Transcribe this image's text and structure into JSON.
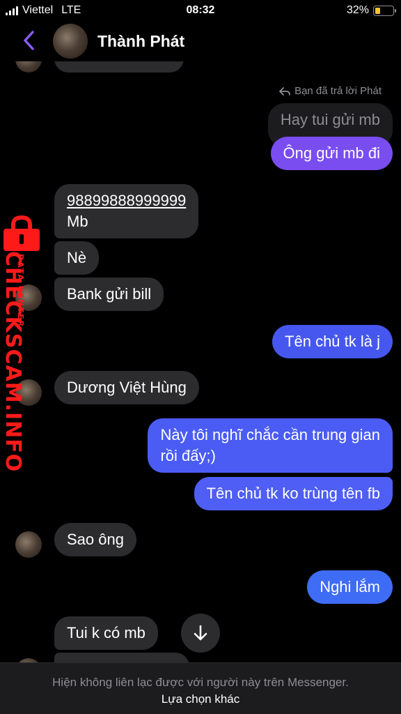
{
  "status_bar": {
    "carrier": "Viettel",
    "network": "LTE",
    "time": "08:32",
    "battery": "32%",
    "battery_level": 0.32,
    "battery_color": "#f4c430"
  },
  "header": {
    "contact_name": "Thành Phát",
    "back_icon": "chevron-left-icon",
    "accent": "#8b5cf6"
  },
  "reply_note": "Bạn đã trả lời Phát",
  "messages": {
    "quoted": "Hay tui gửi mb",
    "m1": "Ông gửi mb đi",
    "m2_line1": "98899888999999",
    "m2_line2": "Mb",
    "m3": "Nè",
    "m4": "Bank gửi bill",
    "m5": "Tên chủ tk là j",
    "m6": "Dương Việt Hùng",
    "m7_line1": "Này tôi nghĩ chắc cần trung gian",
    "m7_line2": "rồi đấy;)",
    "m8": "Tên chủ tk ko trùng tên fb",
    "m9": "Sao ông",
    "m10": "Nghi lắm",
    "m11": "Tui k có mb"
  },
  "watermark": {
    "main": "CHECKSCAM.INFO",
    "sub": "DATA CENTER"
  },
  "footer": {
    "note": "Hiện không liên lạc được với người này trên Messenger.",
    "link": "Lựa chọn khác"
  },
  "colors": {
    "incoming": "#2c2c2e",
    "outgoing": "#3e6af6",
    "outgoing_purple": "#7a4df0",
    "watermark": "#ff1a1a"
  }
}
